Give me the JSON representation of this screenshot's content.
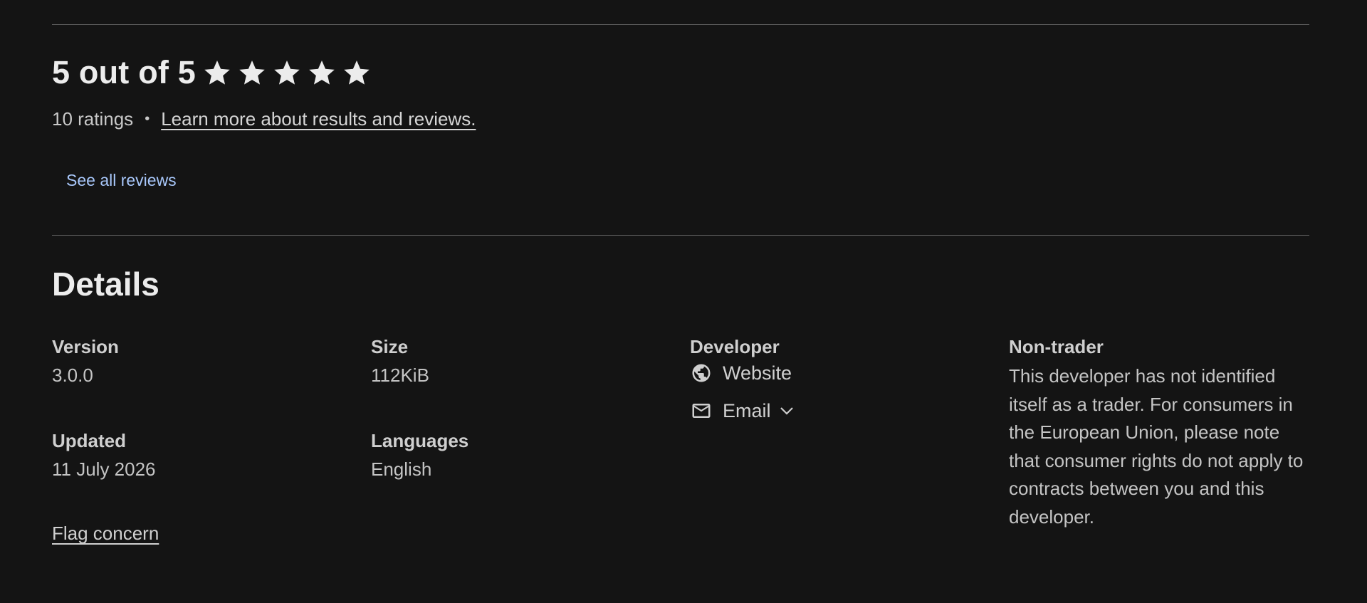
{
  "rating": {
    "heading": "5 out of 5",
    "stars_filled": 5,
    "stars_total": 5,
    "count_text": "10 ratings",
    "separator": "•",
    "learn_more": "Learn more about results and reviews.",
    "see_all": "See all reviews"
  },
  "details": {
    "title": "Details",
    "version": {
      "label": "Version",
      "value": "3.0.0"
    },
    "size": {
      "label": "Size",
      "value": "112KiB"
    },
    "updated": {
      "label": "Updated",
      "value": "11 July 2026"
    },
    "languages": {
      "label": "Languages",
      "value": "English"
    },
    "developer": {
      "label": "Developer",
      "website": "Website",
      "email": "Email"
    },
    "non_trader": {
      "label": "Non-trader",
      "text": "This developer has not identified itself as a trader. For consumers in the European Union, please note that consumer rights do not apply to contracts between you and this developer."
    },
    "flag_concern": "Flag concern"
  },
  "colors": {
    "background": "#141414",
    "link_accent": "#a8c7fa",
    "star": "#ececec"
  }
}
